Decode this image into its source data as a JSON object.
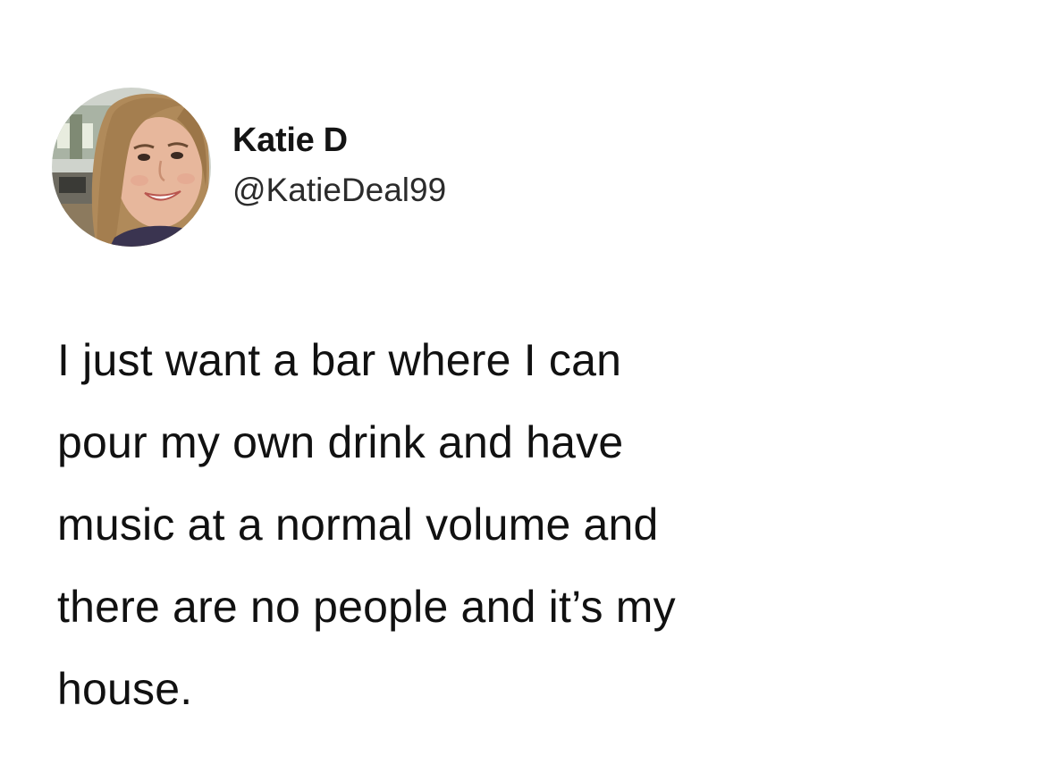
{
  "tweet": {
    "author": {
      "display_name": "Katie D",
      "handle": "@KatieDeal99",
      "avatar_icon": "profile-photo-avatar"
    },
    "text_lines": [
      "I just want a bar where I can",
      "pour my own drink and have",
      "music at a normal volume and",
      "there are no people and it’s my",
      "house."
    ]
  },
  "colors": {
    "background": "#ffffff",
    "text": "#141414",
    "handle": "#2b2b2b"
  }
}
